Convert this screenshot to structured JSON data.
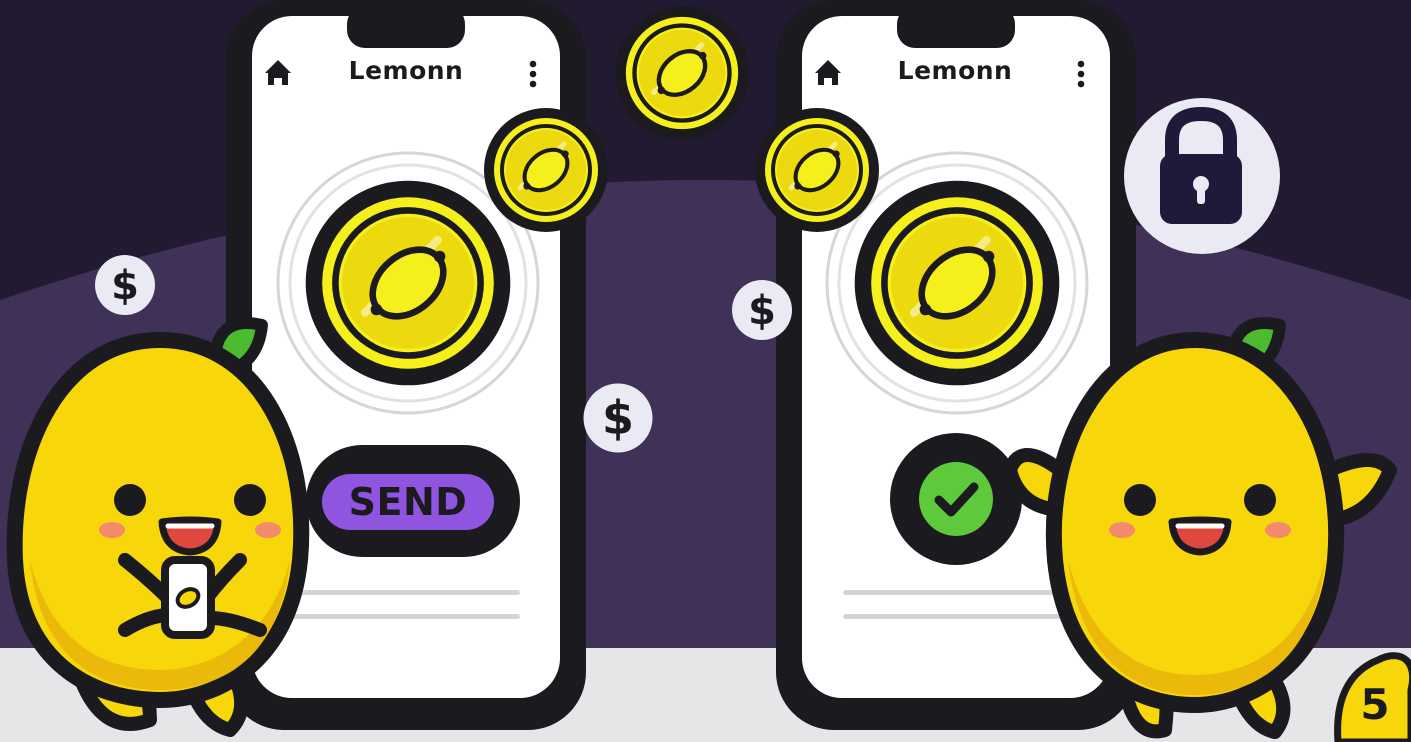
{
  "app": {
    "name": "Lemonn"
  },
  "left_phone": {
    "title": "Lemonn",
    "home_icon": "home-icon",
    "menu_icon": "more-vertical-icon",
    "action_label": "SEND",
    "action_icon": "send-button"
  },
  "right_phone": {
    "title": "Lemonn",
    "home_icon": "home-icon",
    "menu_icon": "more-vertical-icon",
    "status_icon": "check-circle-icon"
  },
  "decorations": {
    "coin_icon": "lemon-coin-icon",
    "dollar_icon": "dollar-icon",
    "lock_icon": "lock-icon",
    "mascot": "lemon-mascot"
  },
  "page": {
    "number": "5"
  },
  "colors": {
    "background_dark": "#221a30",
    "background_purple": "#3f3157",
    "floor": "#e6e6e8",
    "outline": "#1b1b1f",
    "lemon_yellow": "#f7d60a",
    "coin_yellow": "#f5ef1c",
    "send_purple": "#8f55e0",
    "check_green": "#5ec93b",
    "leaf_green": "#4cbb2f"
  }
}
